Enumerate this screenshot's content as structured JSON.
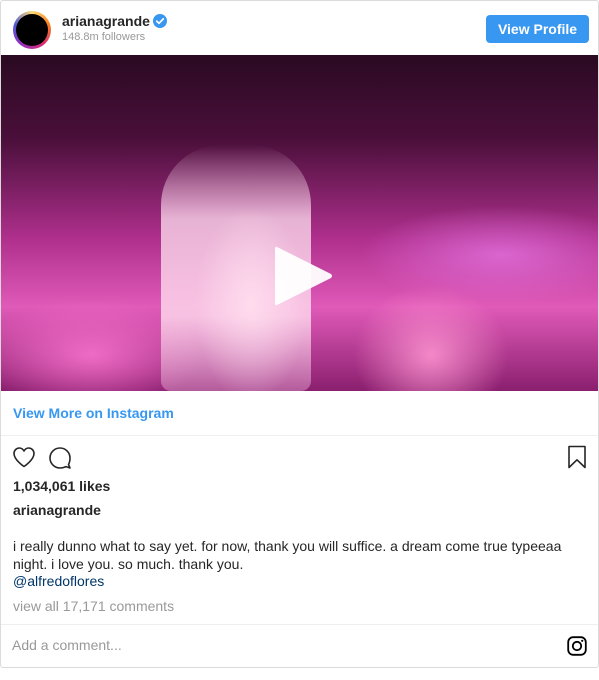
{
  "header": {
    "username": "arianagrande",
    "followers": "148.8m followers",
    "view_profile_label": "View Profile"
  },
  "media": {
    "type": "video",
    "play_icon": "play-icon"
  },
  "view_more": {
    "label": "View More on Instagram"
  },
  "actions": {
    "icons": [
      "heart-icon",
      "comment-icon",
      "bookmark-icon"
    ]
  },
  "likes": "1,034,061 likes",
  "caption": {
    "username": "arianagrande",
    "text": "i really dunno what to say yet. for now, thank you will suffice. a dream come true typeeaa night. i love you. so much. thank you.",
    "mention": "@alfredoflores"
  },
  "comments": {
    "view_all": "view all 17,171 comments"
  },
  "comment_bar": {
    "placeholder": "Add a comment...",
    "logo_icon": "instagram-icon"
  },
  "colors": {
    "accent": "#3897f0",
    "link": "#003569",
    "muted": "#999999",
    "verified": "#3897f0"
  }
}
